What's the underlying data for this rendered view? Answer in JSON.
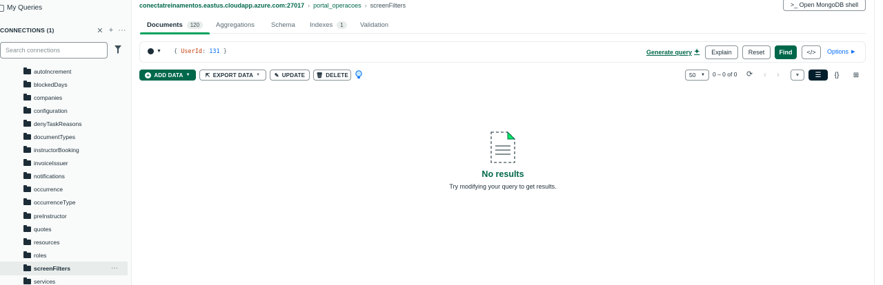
{
  "sidebar": {
    "my_queries": "My Queries",
    "connections_title": "CONNECTIONS (1)",
    "search_placeholder": "Search connections",
    "collections": [
      {
        "label": "autoIncrement"
      },
      {
        "label": "blockedDays"
      },
      {
        "label": "companies"
      },
      {
        "label": "configuration"
      },
      {
        "label": "denyTaskReasons"
      },
      {
        "label": "documentTypes"
      },
      {
        "label": "instructorBooking"
      },
      {
        "label": "invoiceIssuer"
      },
      {
        "label": "notifications"
      },
      {
        "label": "occurrence"
      },
      {
        "label": "occurrenceType"
      },
      {
        "label": "preInstructor"
      },
      {
        "label": "quotes"
      },
      {
        "label": "resources"
      },
      {
        "label": "roles"
      },
      {
        "label": "screenFilters"
      },
      {
        "label": "services"
      }
    ],
    "active_collection": "screenFilters",
    "more_label": "···"
  },
  "breadcrumb": {
    "host": "conectatreinamentos.eastus.cloudapp.azure.com:27017",
    "database": "portal_operacoes",
    "collection": "screenFilters"
  },
  "shell_button": ">_  Open MongoDB shell",
  "tabs": [
    {
      "label": "Documents",
      "count": "120"
    },
    {
      "label": "Aggregations"
    },
    {
      "label": "Schema"
    },
    {
      "label": "Indexes",
      "count": "1"
    },
    {
      "label": "Validation"
    }
  ],
  "query": {
    "open": "{",
    "key": "UserId",
    "colon": ":",
    "value": "131",
    "close": "}",
    "generate": "Generate query",
    "explain": "Explain",
    "reset": "Reset",
    "find": "Find",
    "code": "</>",
    "options": "Options"
  },
  "toolbar": {
    "add_data": "ADD DATA",
    "export_data": "EXPORT DATA",
    "update": "UPDATE",
    "delete": "DELETE",
    "page_size": "50",
    "range": "0 – 0 of 0"
  },
  "empty": {
    "title": "No results",
    "subtitle": "Try modifying your query to get results."
  },
  "colors": {
    "brand_green": "#00684a",
    "accent_green": "#00a35c",
    "link_blue": "#016bf8"
  }
}
